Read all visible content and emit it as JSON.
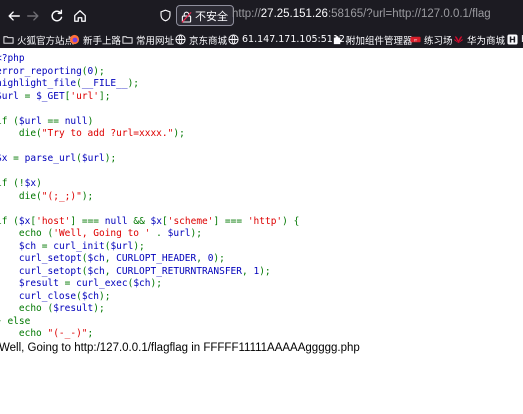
{
  "browser": {
    "insecure_label": "不安全",
    "url": {
      "scheme": "http://",
      "host": "27.25.151.26",
      "rest": ":58165/?url=http://127.0.0.1/flag"
    }
  },
  "bookmarks": [
    {
      "label": "火狐官方站点",
      "icon": "folder-icon"
    },
    {
      "label": "新手上路",
      "icon": "firefox-icon"
    },
    {
      "label": "常用网址",
      "icon": "folder-icon"
    },
    {
      "label": "京东商城",
      "icon": "globe-icon"
    },
    {
      "label": "61.147.171.105:5112...",
      "icon": "globe-icon"
    },
    {
      "label": "附加组件管理器",
      "icon": "addons-icon"
    },
    {
      "label": "练习场",
      "icon": "practice-icon"
    },
    {
      "label": "华为商城",
      "icon": "huawei-icon"
    },
    {
      "label": "H",
      "icon": "h-icon"
    }
  ],
  "code_lines": [
    [
      {
        "t": "<?php",
        "c": "def"
      }
    ],
    [
      {
        "t": "error_reporting",
        "c": "def"
      },
      {
        "t": "(",
        "c": "kw"
      },
      {
        "t": "0",
        "c": "def"
      },
      {
        "t": ");",
        "c": "kw"
      }
    ],
    [
      {
        "t": "highlight_file",
        "c": "def"
      },
      {
        "t": "(",
        "c": "kw"
      },
      {
        "t": "__FILE__",
        "c": "def"
      },
      {
        "t": ");",
        "c": "kw"
      }
    ],
    [
      {
        "t": "$url ",
        "c": "def"
      },
      {
        "t": "= ",
        "c": "kw"
      },
      {
        "t": "$_GET",
        "c": "def"
      },
      {
        "t": "[",
        "c": "kw"
      },
      {
        "t": "'url'",
        "c": "str"
      },
      {
        "t": "];",
        "c": "kw"
      }
    ],
    [],
    [
      {
        "t": "if ",
        "c": "kw"
      },
      {
        "t": "(",
        "c": "kw"
      },
      {
        "t": "$url ",
        "c": "def"
      },
      {
        "t": "== ",
        "c": "kw"
      },
      {
        "t": "null",
        "c": "def"
      },
      {
        "t": ")",
        "c": "kw"
      }
    ],
    [
      {
        "t": "    die",
        "c": "kw"
      },
      {
        "t": "(",
        "c": "kw"
      },
      {
        "t": "\"Try to add ?url=xxxx.\"",
        "c": "str"
      },
      {
        "t": ");",
        "c": "kw"
      }
    ],
    [],
    [
      {
        "t": "$x ",
        "c": "def"
      },
      {
        "t": "= ",
        "c": "kw"
      },
      {
        "t": "parse_url",
        "c": "def"
      },
      {
        "t": "(",
        "c": "kw"
      },
      {
        "t": "$url",
        "c": "def"
      },
      {
        "t": ");",
        "c": "kw"
      }
    ],
    [],
    [
      {
        "t": "if ",
        "c": "kw"
      },
      {
        "t": "(!",
        "c": "kw"
      },
      {
        "t": "$x",
        "c": "def"
      },
      {
        "t": ")",
        "c": "kw"
      }
    ],
    [
      {
        "t": "    die",
        "c": "kw"
      },
      {
        "t": "(",
        "c": "kw"
      },
      {
        "t": "\"(;_;)\"",
        "c": "str"
      },
      {
        "t": ");",
        "c": "kw"
      }
    ],
    [],
    [
      {
        "t": "if ",
        "c": "kw"
      },
      {
        "t": "(",
        "c": "kw"
      },
      {
        "t": "$x",
        "c": "def"
      },
      {
        "t": "[",
        "c": "kw"
      },
      {
        "t": "'host'",
        "c": "str"
      },
      {
        "t": "] === ",
        "c": "kw"
      },
      {
        "t": "null ",
        "c": "def"
      },
      {
        "t": "&& ",
        "c": "kw"
      },
      {
        "t": "$x",
        "c": "def"
      },
      {
        "t": "[",
        "c": "kw"
      },
      {
        "t": "'scheme'",
        "c": "str"
      },
      {
        "t": "] === ",
        "c": "kw"
      },
      {
        "t": "'http'",
        "c": "str"
      },
      {
        "t": ") {",
        "c": "kw"
      }
    ],
    [
      {
        "t": "    echo ",
        "c": "kw"
      },
      {
        "t": "(",
        "c": "kw"
      },
      {
        "t": "'Well, Going to ' ",
        "c": "str"
      },
      {
        "t": ". ",
        "c": "kw"
      },
      {
        "t": "$url",
        "c": "def"
      },
      {
        "t": ");",
        "c": "kw"
      }
    ],
    [
      {
        "t": "    $ch ",
        "c": "def"
      },
      {
        "t": "= ",
        "c": "kw"
      },
      {
        "t": "curl_init",
        "c": "def"
      },
      {
        "t": "(",
        "c": "kw"
      },
      {
        "t": "$url",
        "c": "def"
      },
      {
        "t": ");",
        "c": "kw"
      }
    ],
    [
      {
        "t": "    curl_setopt",
        "c": "def"
      },
      {
        "t": "(",
        "c": "kw"
      },
      {
        "t": "$ch",
        "c": "def"
      },
      {
        "t": ", ",
        "c": "kw"
      },
      {
        "t": "CURLOPT_HEADER",
        "c": "def"
      },
      {
        "t": ", ",
        "c": "kw"
      },
      {
        "t": "0",
        "c": "def"
      },
      {
        "t": ");",
        "c": "kw"
      }
    ],
    [
      {
        "t": "    curl_setopt",
        "c": "def"
      },
      {
        "t": "(",
        "c": "kw"
      },
      {
        "t": "$ch",
        "c": "def"
      },
      {
        "t": ", ",
        "c": "kw"
      },
      {
        "t": "CURLOPT_RETURNTRANSFER",
        "c": "def"
      },
      {
        "t": ", ",
        "c": "kw"
      },
      {
        "t": "1",
        "c": "def"
      },
      {
        "t": ");",
        "c": "kw"
      }
    ],
    [
      {
        "t": "    $result ",
        "c": "def"
      },
      {
        "t": "= ",
        "c": "kw"
      },
      {
        "t": "curl_exec",
        "c": "def"
      },
      {
        "t": "(",
        "c": "kw"
      },
      {
        "t": "$ch",
        "c": "def"
      },
      {
        "t": ");",
        "c": "kw"
      }
    ],
    [
      {
        "t": "    curl_close",
        "c": "def"
      },
      {
        "t": "(",
        "c": "kw"
      },
      {
        "t": "$ch",
        "c": "def"
      },
      {
        "t": ");",
        "c": "kw"
      }
    ],
    [
      {
        "t": "    echo ",
        "c": "kw"
      },
      {
        "t": "(",
        "c": "kw"
      },
      {
        "t": "$result",
        "c": "def"
      },
      {
        "t": ");",
        "c": "kw"
      }
    ],
    [
      {
        "t": "} else",
        "c": "kw"
      }
    ],
    [
      {
        "t": "    echo ",
        "c": "kw"
      },
      {
        "t": "\"(-_-)\"",
        "c": "str"
      },
      {
        "t": ";",
        "c": "kw"
      }
    ]
  ],
  "output_text": "Well, Going to http:/127.0.0.1/flagflag in FFFFF11111AAAAAggggg.php",
  "colors": {
    "php_default": "#0000bb",
    "php_keyword": "#007700",
    "php_string": "#dd0000",
    "toolbar_bg": "#1c1b22"
  }
}
